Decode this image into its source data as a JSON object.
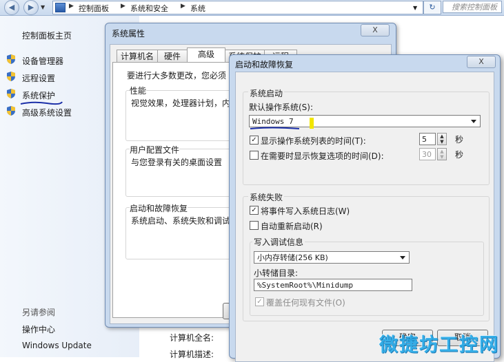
{
  "address_bar": {
    "crumbs": [
      "控制面板",
      "系统和安全",
      "系统"
    ],
    "search_placeholder": "搜索控制面板"
  },
  "left_pane": {
    "home": "控制面板主页",
    "links": [
      "设备管理器",
      "远程设置",
      "系统保护",
      "高级系统设置"
    ],
    "see_also_title": "另请参阅",
    "see_also": [
      "操作中心",
      "Windows Update"
    ]
  },
  "main_window": {
    "labels": [
      "计算机全名:",
      "计算机描述:"
    ]
  },
  "system_properties": {
    "title": "系统属性",
    "close": "X",
    "tabs": [
      "计算机名",
      "硬件",
      "高级",
      "系统保护",
      "远程"
    ],
    "active_tab": "高级",
    "intro": "要进行大多数更改，您必须",
    "performance": {
      "title": "性能",
      "text": "视觉效果，处理器计划，内"
    },
    "user_profiles": {
      "title": "用户配置文件",
      "text": "与您登录有关的桌面设置"
    },
    "startup_recovery": {
      "title": "启动和故障恢复",
      "text": "系统启动、系统失败和调试"
    }
  },
  "startup_dialog": {
    "title": "启动和故障恢复",
    "close": "X",
    "system_startup": {
      "title": "系统启动",
      "default_os_label": "默认操作系统(S):",
      "default_os_value": "Windows 7",
      "show_list_label": "显示操作系统列表的时间(T):",
      "show_list_checked": true,
      "show_list_value": "5",
      "show_recovery_label": "在需要时显示恢复选项的时间(D):",
      "show_recovery_checked": false,
      "show_recovery_value": "30",
      "seconds": "秒"
    },
    "system_failure": {
      "title": "系统失败",
      "write_event_label": "将事件写入系统日志(W)",
      "write_event_checked": true,
      "auto_restart_label": "自动重新启动(R)",
      "auto_restart_checked": false,
      "debug_info_title": "写入调试信息",
      "dump_type": "小内存转储(256 KB)",
      "dump_dir_label": "小转储目录:",
      "dump_dir_value": "%SystemRoot%\\Minidump",
      "overwrite_label": "覆盖任何现有文件(O)",
      "overwrite_checked": true,
      "overwrite_disabled": true
    },
    "buttons": {
      "ok": "确定",
      "cancel": "取消"
    }
  },
  "watermark": "微捷坊工控网",
  "colors": {
    "annotation_blue": "#1b2fa8",
    "annotation_yellow": "#f2e600"
  }
}
